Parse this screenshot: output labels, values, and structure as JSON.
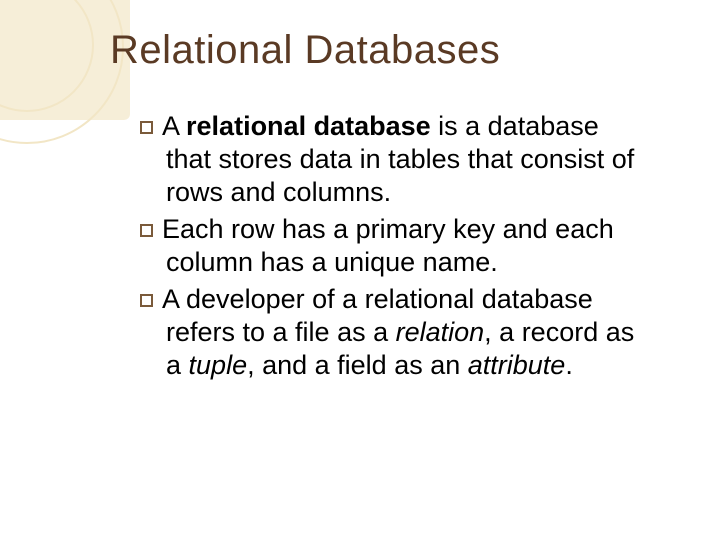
{
  "title": "Relational Databases",
  "bullets": [
    {
      "pre": "A ",
      "bold": "relational database",
      "post": " is a database that stores data in tables that consist of rows and columns."
    },
    {
      "pre": "Each row has a primary key and each column has a unique name.",
      "bold": "",
      "post": ""
    }
  ],
  "bullet3": {
    "a": "A developer of a relational database refers to a file as a ",
    "i1": "relation",
    "b": ", a record as a ",
    "i2": "tuple",
    "c": ", and a field as an ",
    "i3": "attribute",
    "d": "."
  }
}
